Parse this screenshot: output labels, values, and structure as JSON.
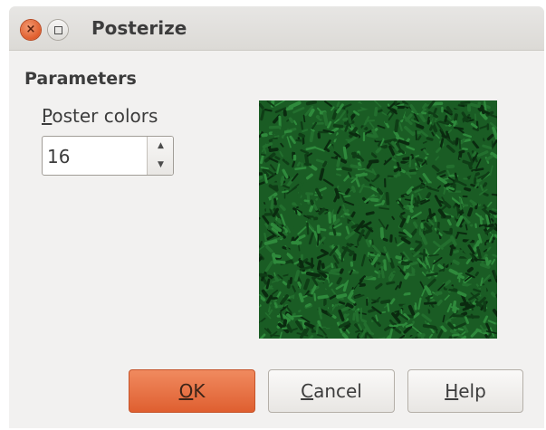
{
  "window": {
    "title": "Posterize",
    "close_glyph": "×",
    "close_icon": "close-icon",
    "maximize_icon": "maximize-icon"
  },
  "parameters": {
    "section_title": "Parameters",
    "poster_colors_label_mnemonic": "P",
    "poster_colors_label_rest": "oster colors",
    "poster_colors_value": "16",
    "spin_up_glyph": "▲",
    "spin_down_glyph": "▼"
  },
  "preview": {
    "description_icon": "image-preview",
    "colors": [
      "#1a5c24",
      "#0f3d16",
      "#2f8a3c",
      "#236f2e",
      "#0a2a0f"
    ]
  },
  "buttons": {
    "ok_mnemonic": "O",
    "ok_rest": "K",
    "cancel_mnemonic": "C",
    "cancel_rest": "ancel",
    "help_mnemonic": "H",
    "help_rest": "elp"
  },
  "colors": {
    "accent": "#df5f30",
    "dialog_bg": "#f2f1f0",
    "text": "#3c3c3c"
  }
}
